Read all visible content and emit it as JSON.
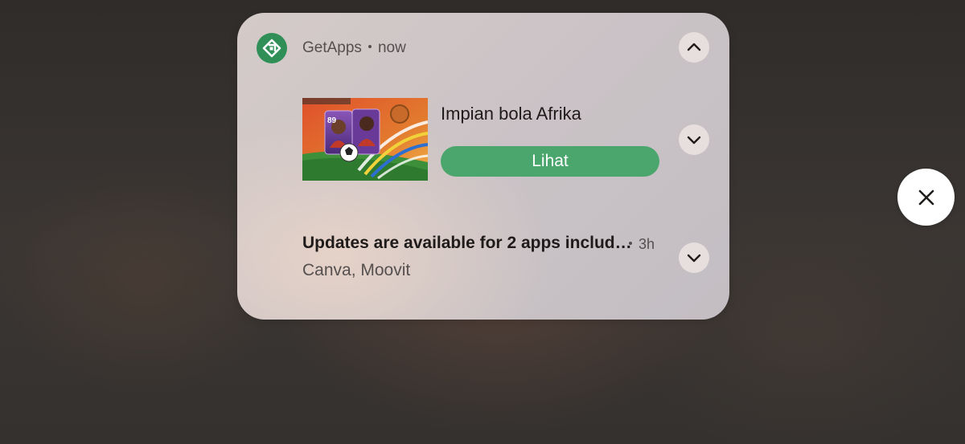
{
  "notification_group": {
    "app_name": "GetApps",
    "time": "now",
    "app_icon": "getapps-logo-icon",
    "collapse_icon": "chevron-up-icon"
  },
  "promo_notification": {
    "title": "Impian bola Afrika",
    "action_label": "Lihat",
    "thumbnail_badge": "89",
    "expand_icon": "chevron-down-icon"
  },
  "update_notification": {
    "title": "Updates are available for 2 apps includ…",
    "time": "3h",
    "subtitle": "Canva, Moovit",
    "expand_icon": "chevron-down-icon"
  },
  "dismiss": {
    "icon": "close-icon"
  },
  "colors": {
    "accent_green": "#4aa66c",
    "app_icon_green": "#2f8f57",
    "card_background": "#cbc3c6"
  }
}
